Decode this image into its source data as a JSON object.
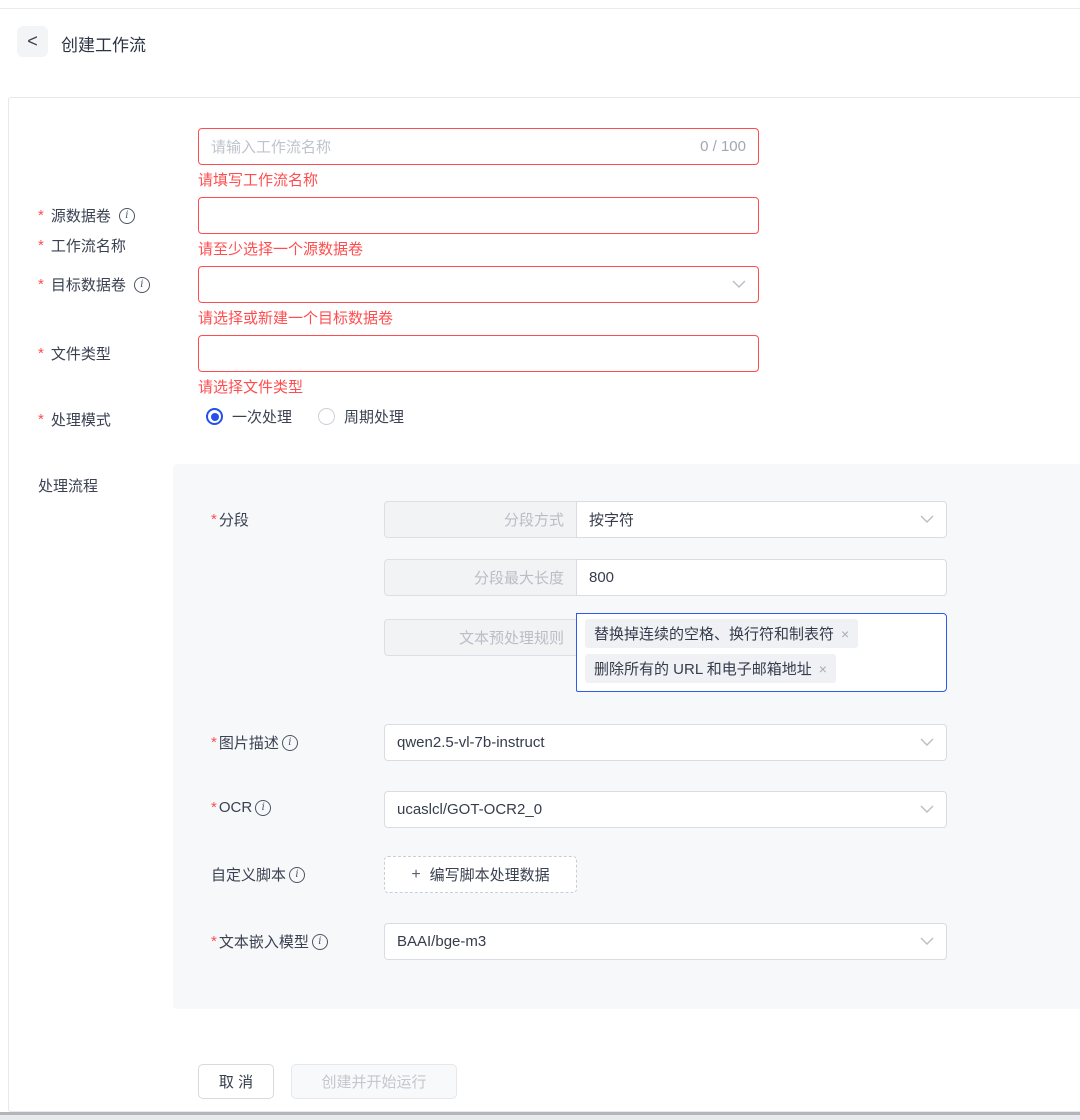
{
  "icons": {
    "back": "<",
    "info": "i",
    "close": "×",
    "plus": "+",
    "required": "*"
  },
  "header": {
    "title": "创建工作流"
  },
  "form": {
    "workflow_name": {
      "label": "工作流名称",
      "placeholder": "请输入工作流名称",
      "counter": "0 / 100",
      "error": "请填写工作流名称"
    },
    "source_volume": {
      "label": "源数据卷",
      "value": "",
      "error": "请至少选择一个源数据卷"
    },
    "target_volume": {
      "label": "目标数据卷",
      "value": "",
      "error": "请选择或新建一个目标数据卷"
    },
    "file_type": {
      "label": "文件类型",
      "value": "",
      "error": "请选择文件类型"
    },
    "process_mode": {
      "label": "处理模式",
      "options": [
        {
          "label": "一次处理",
          "selected": true
        },
        {
          "label": "周期处理",
          "selected": false
        }
      ]
    },
    "pipeline": {
      "label": "处理流程",
      "segment": {
        "label": "分段",
        "method_label": "分段方式",
        "method_value": "按字符",
        "max_length_label": "分段最大长度",
        "max_length_value": "800",
        "rules_label": "文本预处理规则",
        "rules": [
          "替换掉连续的空格、换行符和制表符",
          "删除所有的 URL 和电子邮箱地址"
        ]
      },
      "image_caption": {
        "label": "图片描述",
        "value": "qwen2.5-vl-7b-instruct"
      },
      "ocr": {
        "label": "OCR",
        "value": "ucaslcl/GOT-OCR2_0"
      },
      "custom_script": {
        "label": "自定义脚本",
        "button_label": "编写脚本处理数据"
      },
      "embedding": {
        "label": "文本嵌入模型",
        "value": "BAAI/bge-m3"
      }
    }
  },
  "footer": {
    "cancel_label": "取 消",
    "submit_label": "创建并开始运行"
  },
  "colors": {
    "error": "#ff4d4f",
    "primary": "#2750e8",
    "focus_border": "#2f5aeb",
    "panel_bg": "#f7f8fa"
  }
}
